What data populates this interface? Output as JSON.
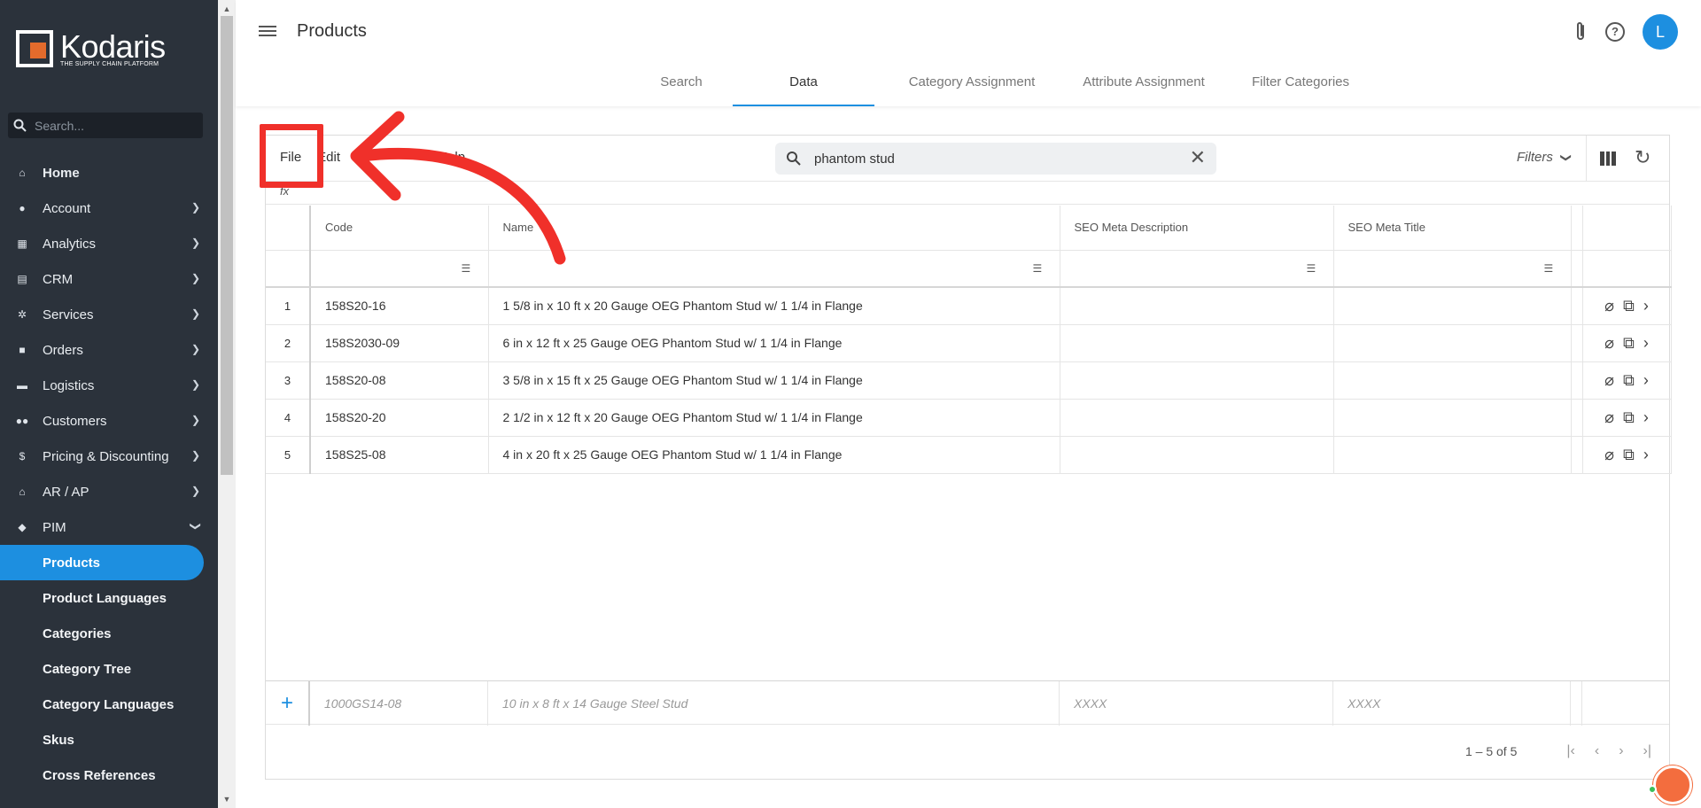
{
  "app": {
    "logo_word": "Kodaris",
    "logo_tagline": "THE SUPPLY CHAIN PLATFORM",
    "search_placeholder": "Search...",
    "accent_color": "#1d8fe0"
  },
  "sidebar": {
    "items": [
      {
        "label": "Home",
        "icon": "home-icon",
        "has_chevron": false
      },
      {
        "label": "Account",
        "icon": "person-icon",
        "has_chevron": true
      },
      {
        "label": "Analytics",
        "icon": "chart-icon",
        "has_chevron": true
      },
      {
        "label": "CRM",
        "icon": "id-card-icon",
        "has_chevron": true
      },
      {
        "label": "Services",
        "icon": "gears-icon",
        "has_chevron": true
      },
      {
        "label": "Orders",
        "icon": "truck-icon",
        "has_chevron": true
      },
      {
        "label": "Logistics",
        "icon": "shipping-icon",
        "has_chevron": true
      },
      {
        "label": "Customers",
        "icon": "people-icon",
        "has_chevron": true
      },
      {
        "label": "Pricing & Discounting",
        "icon": "dollar-icon",
        "has_chevron": true
      },
      {
        "label": "AR / AP",
        "icon": "bank-icon",
        "has_chevron": true
      },
      {
        "label": "PIM",
        "icon": "tag-icon",
        "has_chevron": true,
        "expanded": true
      }
    ],
    "pim_subitems": [
      "Products",
      "Product Languages",
      "Categories",
      "Category Tree",
      "Category Languages",
      "Skus",
      "Cross References"
    ],
    "active_subitem": "Products"
  },
  "header": {
    "title": "Products",
    "avatar_initial": "L",
    "tabs": [
      "Search",
      "Data",
      "Category Assignment",
      "Attribute Assignment",
      "Filter Categories"
    ],
    "active_tab": "Data"
  },
  "toolbar": {
    "menu": [
      "File",
      "Edit",
      "I",
      "Help"
    ],
    "search_value": "phantom stud",
    "filters_label": "Filters",
    "fx_label": "fx"
  },
  "grid": {
    "columns": [
      "Code",
      "Name",
      "SEO Meta Description",
      "SEO Meta Title"
    ],
    "rows": [
      {
        "num": "1",
        "code": "158S20-16",
        "name": "1 5/8 in x 10 ft x 20 Gauge OEG Phantom Stud w/ 1 1/4 in Flange",
        "seo_desc": "",
        "seo_title": ""
      },
      {
        "num": "2",
        "code": "158S2030-09",
        "name": "6 in x 12 ft x 25 Gauge OEG Phantom Stud w/ 1 1/4 in Flange",
        "seo_desc": "",
        "seo_title": ""
      },
      {
        "num": "3",
        "code": "158S20-08",
        "name": "3 5/8 in x 15 ft x 25 Gauge OEG Phantom Stud w/ 1 1/4 in Flange",
        "seo_desc": "",
        "seo_title": ""
      },
      {
        "num": "4",
        "code": "158S20-20",
        "name": "2 1/2 in x 12 ft x 20 Gauge OEG Phantom Stud w/ 1 1/4 in Flange",
        "seo_desc": "",
        "seo_title": ""
      },
      {
        "num": "5",
        "code": "158S25-08",
        "name": "4 in x 20 ft x 25 Gauge OEG Phantom Stud w/ 1 1/4 in Flange",
        "seo_desc": "",
        "seo_title": ""
      }
    ],
    "new_row_placeholders": {
      "code": "1000GS14-08",
      "name": "10 in x 8 ft x 14 Gauge Steel Stud",
      "seo_desc": "XXXX",
      "seo_title": "XXXX"
    },
    "pager_text": "1 – 5 of 5"
  },
  "annotation": {
    "highlight_color": "#f0302a"
  }
}
